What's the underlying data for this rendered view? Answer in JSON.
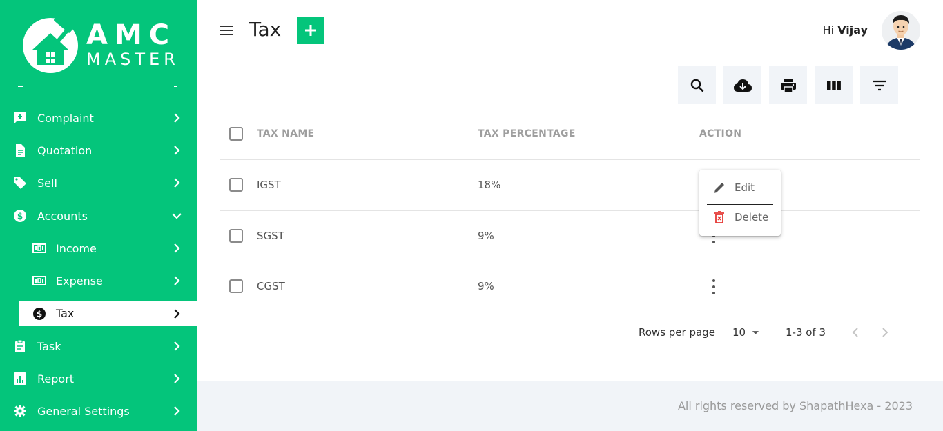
{
  "brand": {
    "line1": "AMC",
    "line2": "MASTER",
    "color": "#04c57b"
  },
  "sidebar": {
    "items": [
      {
        "label": "Complaint",
        "icon": "complaint-icon"
      },
      {
        "label": "Quotation",
        "icon": "document-icon"
      },
      {
        "label": "Sell",
        "icon": "tag-icon"
      },
      {
        "label": "Accounts",
        "icon": "dollar-circle-icon",
        "expanded": true
      },
      {
        "label": "Income",
        "icon": "money-icon",
        "sub": true
      },
      {
        "label": "Expense",
        "icon": "money-icon",
        "sub": true
      },
      {
        "label": "Tax",
        "icon": "dollar-circle-icon",
        "sub": true,
        "active": true
      },
      {
        "label": "Task",
        "icon": "clipboard-icon"
      },
      {
        "label": "Report",
        "icon": "report-icon"
      },
      {
        "label": "General Settings",
        "icon": "gear-icon"
      }
    ]
  },
  "header": {
    "title": "Tax",
    "greeting": "Hi",
    "user_name": "Vijay"
  },
  "toolbar": {
    "buttons": [
      "search-icon",
      "cloud-download-icon",
      "print-icon",
      "view-columns-icon",
      "filter-icon"
    ]
  },
  "table": {
    "columns": [
      "TAX NAME",
      "TAX PERCENTAGE",
      "ACTION"
    ],
    "rows": [
      {
        "name": "IGST",
        "percentage": "18%"
      },
      {
        "name": "SGST",
        "percentage": "9%"
      },
      {
        "name": "CGST",
        "percentage": "9%"
      }
    ]
  },
  "action_menu": {
    "edit": "Edit",
    "delete": "Delete",
    "delete_color": "#e53935"
  },
  "pagination": {
    "rows_per_page_label": "Rows per page",
    "rows_per_page": "10",
    "range": "1-3 of 3"
  },
  "footer": {
    "text": "All rights reserved by ShapathHexa - 2023"
  }
}
